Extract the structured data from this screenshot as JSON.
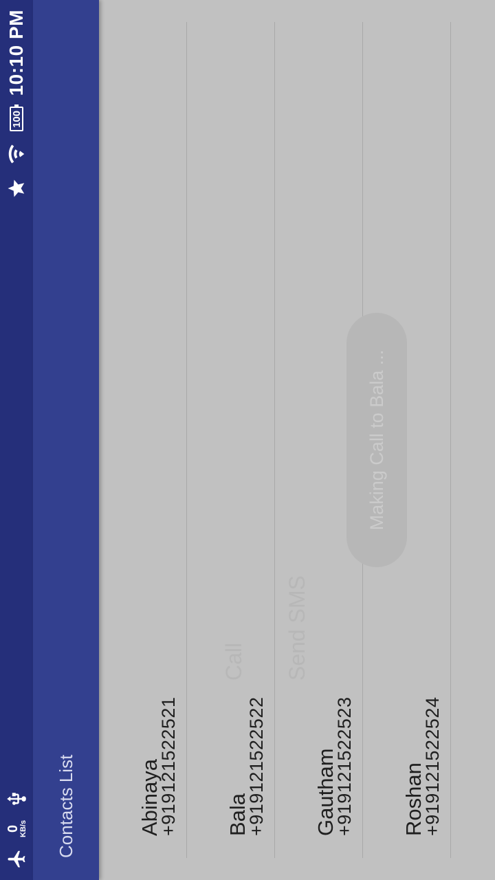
{
  "status_bar": {
    "speed_value": "0",
    "speed_unit": "KB/s",
    "battery": "100",
    "time": "10:10 PM",
    "icons": [
      "airplane-mode-icon",
      "usb-icon",
      "star-icon",
      "wifi-icon",
      "battery-icon"
    ]
  },
  "app_bar": {
    "title": "Contacts List"
  },
  "contacts": [
    {
      "name": "Abinaya",
      "phone": "+919121522521"
    },
    {
      "name": "Bala",
      "phone": "+919121522522"
    },
    {
      "name": "Gautham",
      "phone": "+919121522523"
    },
    {
      "name": "Roshan",
      "phone": "+919121522524"
    }
  ],
  "ghost_menu": {
    "item_1": "Call",
    "item_2": "Send SMS"
  },
  "toast": {
    "message": "Making Call to Bala ..."
  },
  "colors": {
    "status_bar": "#252f7a",
    "app_bar": "#33408f",
    "background": "#c1c1c1"
  }
}
